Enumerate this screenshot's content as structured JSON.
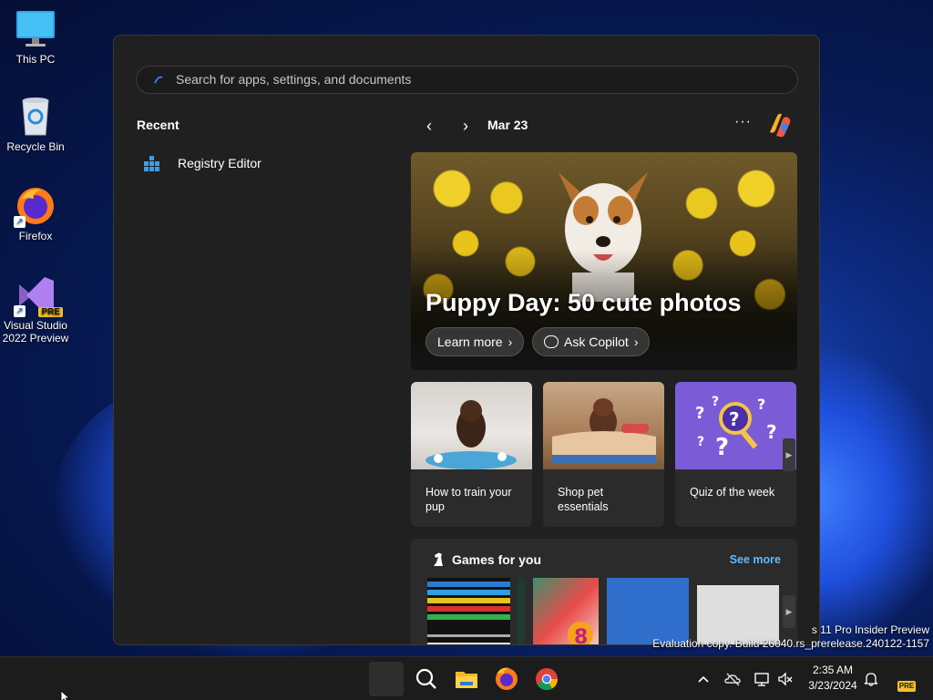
{
  "desktop": {
    "icons": [
      {
        "label": "This PC"
      },
      {
        "label": "Recycle Bin"
      },
      {
        "label": "Firefox"
      },
      {
        "label_line1": "Visual Studio",
        "label_line2": "2022 Preview",
        "badge": "PRE"
      }
    ]
  },
  "start_menu": {
    "search": {
      "placeholder": "Search for apps, settings, and documents"
    },
    "recent": {
      "heading": "Recent",
      "items": [
        {
          "label": "Registry Editor",
          "icon": "registry-editor-icon"
        }
      ]
    },
    "feed": {
      "date": "Mar 23",
      "more": "···",
      "hero": {
        "title": "Puppy Day: 50 cute photos",
        "learn_more": "Learn more",
        "ask_copilot": "Ask Copilot"
      },
      "cards": [
        {
          "caption": "How to train your pup"
        },
        {
          "caption": "Shop pet essentials"
        },
        {
          "caption": "Quiz of the week"
        }
      ],
      "games": {
        "heading": "Games for you",
        "see_more": "See more"
      }
    }
  },
  "watermark": {
    "line1": "s 11 Pro Insider Preview",
    "line2": "Evaluation copy. Build 26040.rs_prerelease.240122-1157"
  },
  "taskbar": {
    "pinned": [
      "start-icon",
      "search-icon",
      "file-explorer-icon",
      "firefox-icon",
      "chrome-icon"
    ],
    "time": "2:35 AM",
    "date": "3/23/2024",
    "tray_badge": "PRE"
  },
  "colors": {
    "accent": "#60b8ff",
    "menu_bg": "#202020",
    "card_bg": "#2b2b2b"
  }
}
